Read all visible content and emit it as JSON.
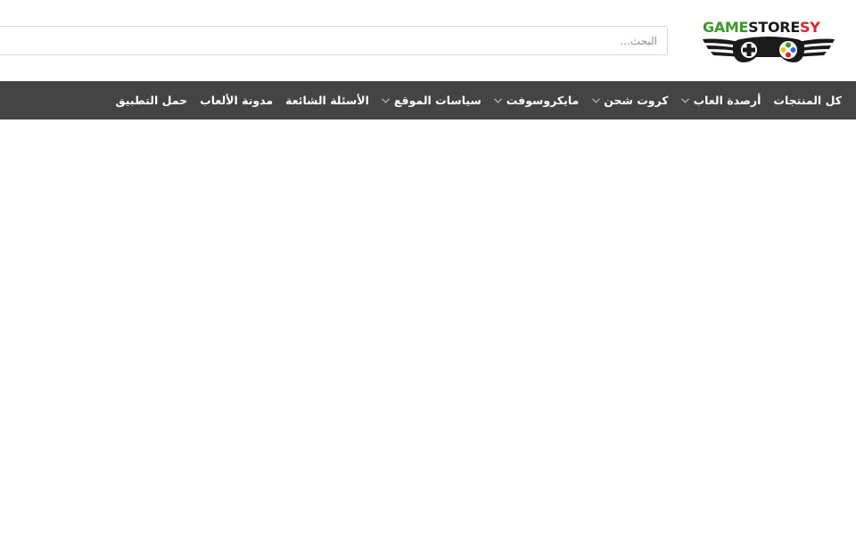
{
  "logo": {
    "part1": "GAME",
    "part2": "STORE",
    "part3": "SY",
    "colors": {
      "green": "#3a9a2a",
      "black": "#1a1a1a",
      "red": "#d8242a"
    },
    "icon": "gamepad-wings-icon"
  },
  "search": {
    "placeholder": "البحث..."
  },
  "nav": {
    "background": "#444444",
    "items": [
      {
        "label": "كل المنتجات",
        "dropdown": false
      },
      {
        "label": "أرصدة العاب",
        "dropdown": true
      },
      {
        "label": "كروت شحن",
        "dropdown": true
      },
      {
        "label": "مايكروسوفت",
        "dropdown": true
      },
      {
        "label": "سياسات الموقع",
        "dropdown": true
      },
      {
        "label": "الأسئلة الشائعة",
        "dropdown": false
      },
      {
        "label": "مدونة الألعاب",
        "dropdown": false
      },
      {
        "label": "حمل التطبيق",
        "dropdown": false
      }
    ]
  }
}
